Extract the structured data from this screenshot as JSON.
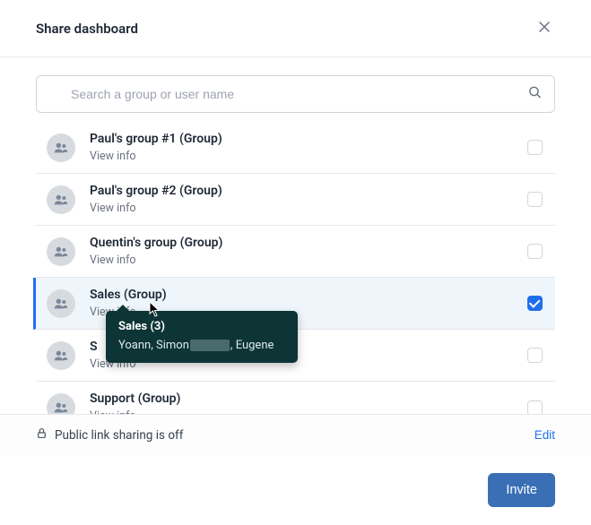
{
  "header": {
    "title": "Share dashboard"
  },
  "search": {
    "placeholder": "Search a group or user name"
  },
  "list": {
    "view_info_label": "View info",
    "items": [
      {
        "title": "Paul's group #1 (Group)",
        "checked": false
      },
      {
        "title": "Paul's group #2 (Group)",
        "checked": false
      },
      {
        "title": "Quentin's group (Group)",
        "checked": false
      },
      {
        "title": "Sales (Group)",
        "checked": true
      },
      {
        "title": "S",
        "checked": false
      },
      {
        "title": "Support (Group)",
        "checked": false
      }
    ]
  },
  "tooltip": {
    "title": "Sales (3)",
    "members_prefix": "Yoann, Simon ",
    "members_suffix": ", Eugene"
  },
  "footer": {
    "public_link_text": "Public link sharing is off",
    "edit_label": "Edit",
    "invite_label": "Invite"
  }
}
